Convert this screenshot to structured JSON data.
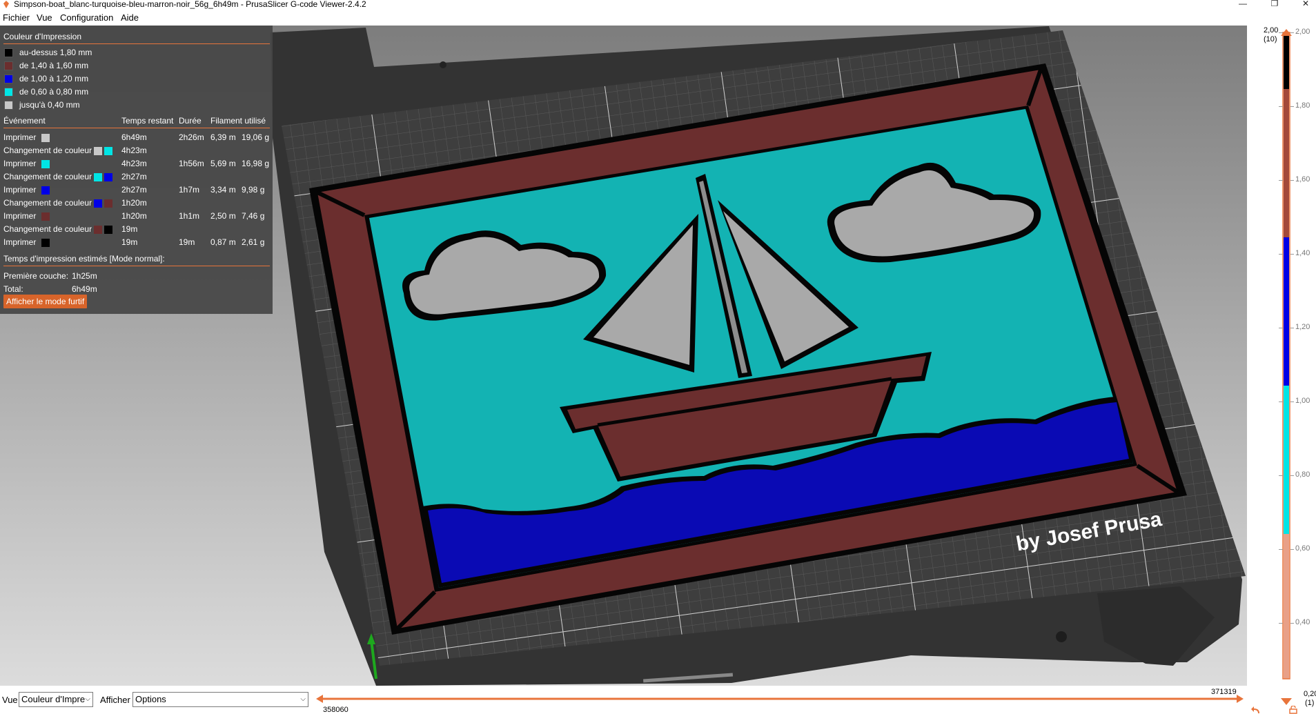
{
  "window": {
    "title": "Simpson-boat_blanc-turquoise-bleu-marron-noir_56g_6h49m - PrusaSlicer G-code Viewer-2.4.2",
    "minimize_glyph": "—",
    "restore_glyph": "❐",
    "close_glyph": "✕"
  },
  "menu": [
    "Fichier",
    "Vue",
    "Configuration",
    "Aide"
  ],
  "legend": {
    "title": "Couleur d'Impression",
    "ranges": [
      {
        "label": "au-dessus 1,80 mm",
        "color": "#000000"
      },
      {
        "label": "de 1,40 à 1,60 mm",
        "color": "#6b2e2e"
      },
      {
        "label": "de 1,00 à 1,20 mm",
        "color": "#0000e6"
      },
      {
        "label": "de 0,60 à 0,80 mm",
        "color": "#00e5e5"
      },
      {
        "label": "jusqu'à 0,40 mm",
        "color": "#c8c8c8"
      }
    ],
    "headers": {
      "event": "Événement",
      "remaining": "Temps restant",
      "duration": "Durée",
      "filament": "Filament utilisé"
    },
    "events": [
      {
        "label": "Imprimer",
        "colors": [
          "#c8c8c8"
        ],
        "remaining": "6h49m",
        "duration": "2h26m",
        "length": "6,39 m",
        "weight": "19,06 g"
      },
      {
        "label": "Changement de couleur",
        "colors": [
          "#c8c8c8",
          "#00e5e5"
        ],
        "remaining": "4h23m",
        "duration": "",
        "length": "",
        "weight": ""
      },
      {
        "label": "Imprimer",
        "colors": [
          "#00e5e5"
        ],
        "remaining": "4h23m",
        "duration": "1h56m",
        "length": "5,69 m",
        "weight": "16,98 g"
      },
      {
        "label": "Changement de couleur",
        "colors": [
          "#00e5e5",
          "#0000e6"
        ],
        "remaining": "2h27m",
        "duration": "",
        "length": "",
        "weight": ""
      },
      {
        "label": "Imprimer",
        "colors": [
          "#0000e6"
        ],
        "remaining": "2h27m",
        "duration": "1h7m",
        "length": "3,34 m",
        "weight": "9,98 g"
      },
      {
        "label": "Changement de couleur",
        "colors": [
          "#0000e6",
          "#6b2e2e"
        ],
        "remaining": "1h20m",
        "duration": "",
        "length": "",
        "weight": ""
      },
      {
        "label": "Imprimer",
        "colors": [
          "#6b2e2e"
        ],
        "remaining": "1h20m",
        "duration": "1h1m",
        "length": "2,50 m",
        "weight": "7,46 g"
      },
      {
        "label": "Changement de couleur",
        "colors": [
          "#6b2e2e",
          "#000000"
        ],
        "remaining": "19m",
        "duration": "",
        "length": "",
        "weight": ""
      },
      {
        "label": "Imprimer",
        "colors": [
          "#000000"
        ],
        "remaining": "19m",
        "duration": "19m",
        "length": "0,87 m",
        "weight": "2,61 g"
      }
    ],
    "estimated_title": "Temps d'impression estimés [Mode normal]:",
    "first_layer_label": "Première couche:",
    "first_layer_value": "1h25m",
    "total_label": "Total:",
    "total_value": "6h49m",
    "stealth_button": "Afficher le mode furtif"
  },
  "scene": {
    "signature": "by Josef Prusa",
    "colors": {
      "frame": "#6b2e2e",
      "sky": "#13b3b3",
      "sea": "#0a0ab4",
      "cloud": "#a9a9a9",
      "outline": "#050505",
      "bed": "#3b3b3b"
    }
  },
  "layer_slider": {
    "top_value": "2,00",
    "top_index": "(10)",
    "bottom_value": "0,20",
    "bottom_index": "(1)",
    "ticks": [
      "2,00",
      "1,80",
      "1,60",
      "1,40",
      "1,20",
      "1,00",
      "0,80",
      "0,60",
      "0,40"
    ],
    "accent_color": "#e8743b"
  },
  "bottom": {
    "view_label": "Vue",
    "view_value": "Couleur d'Impre",
    "show_label": "Afficher",
    "show_value": "Options",
    "move_end_value": "371319",
    "move_start_value": "358060"
  }
}
